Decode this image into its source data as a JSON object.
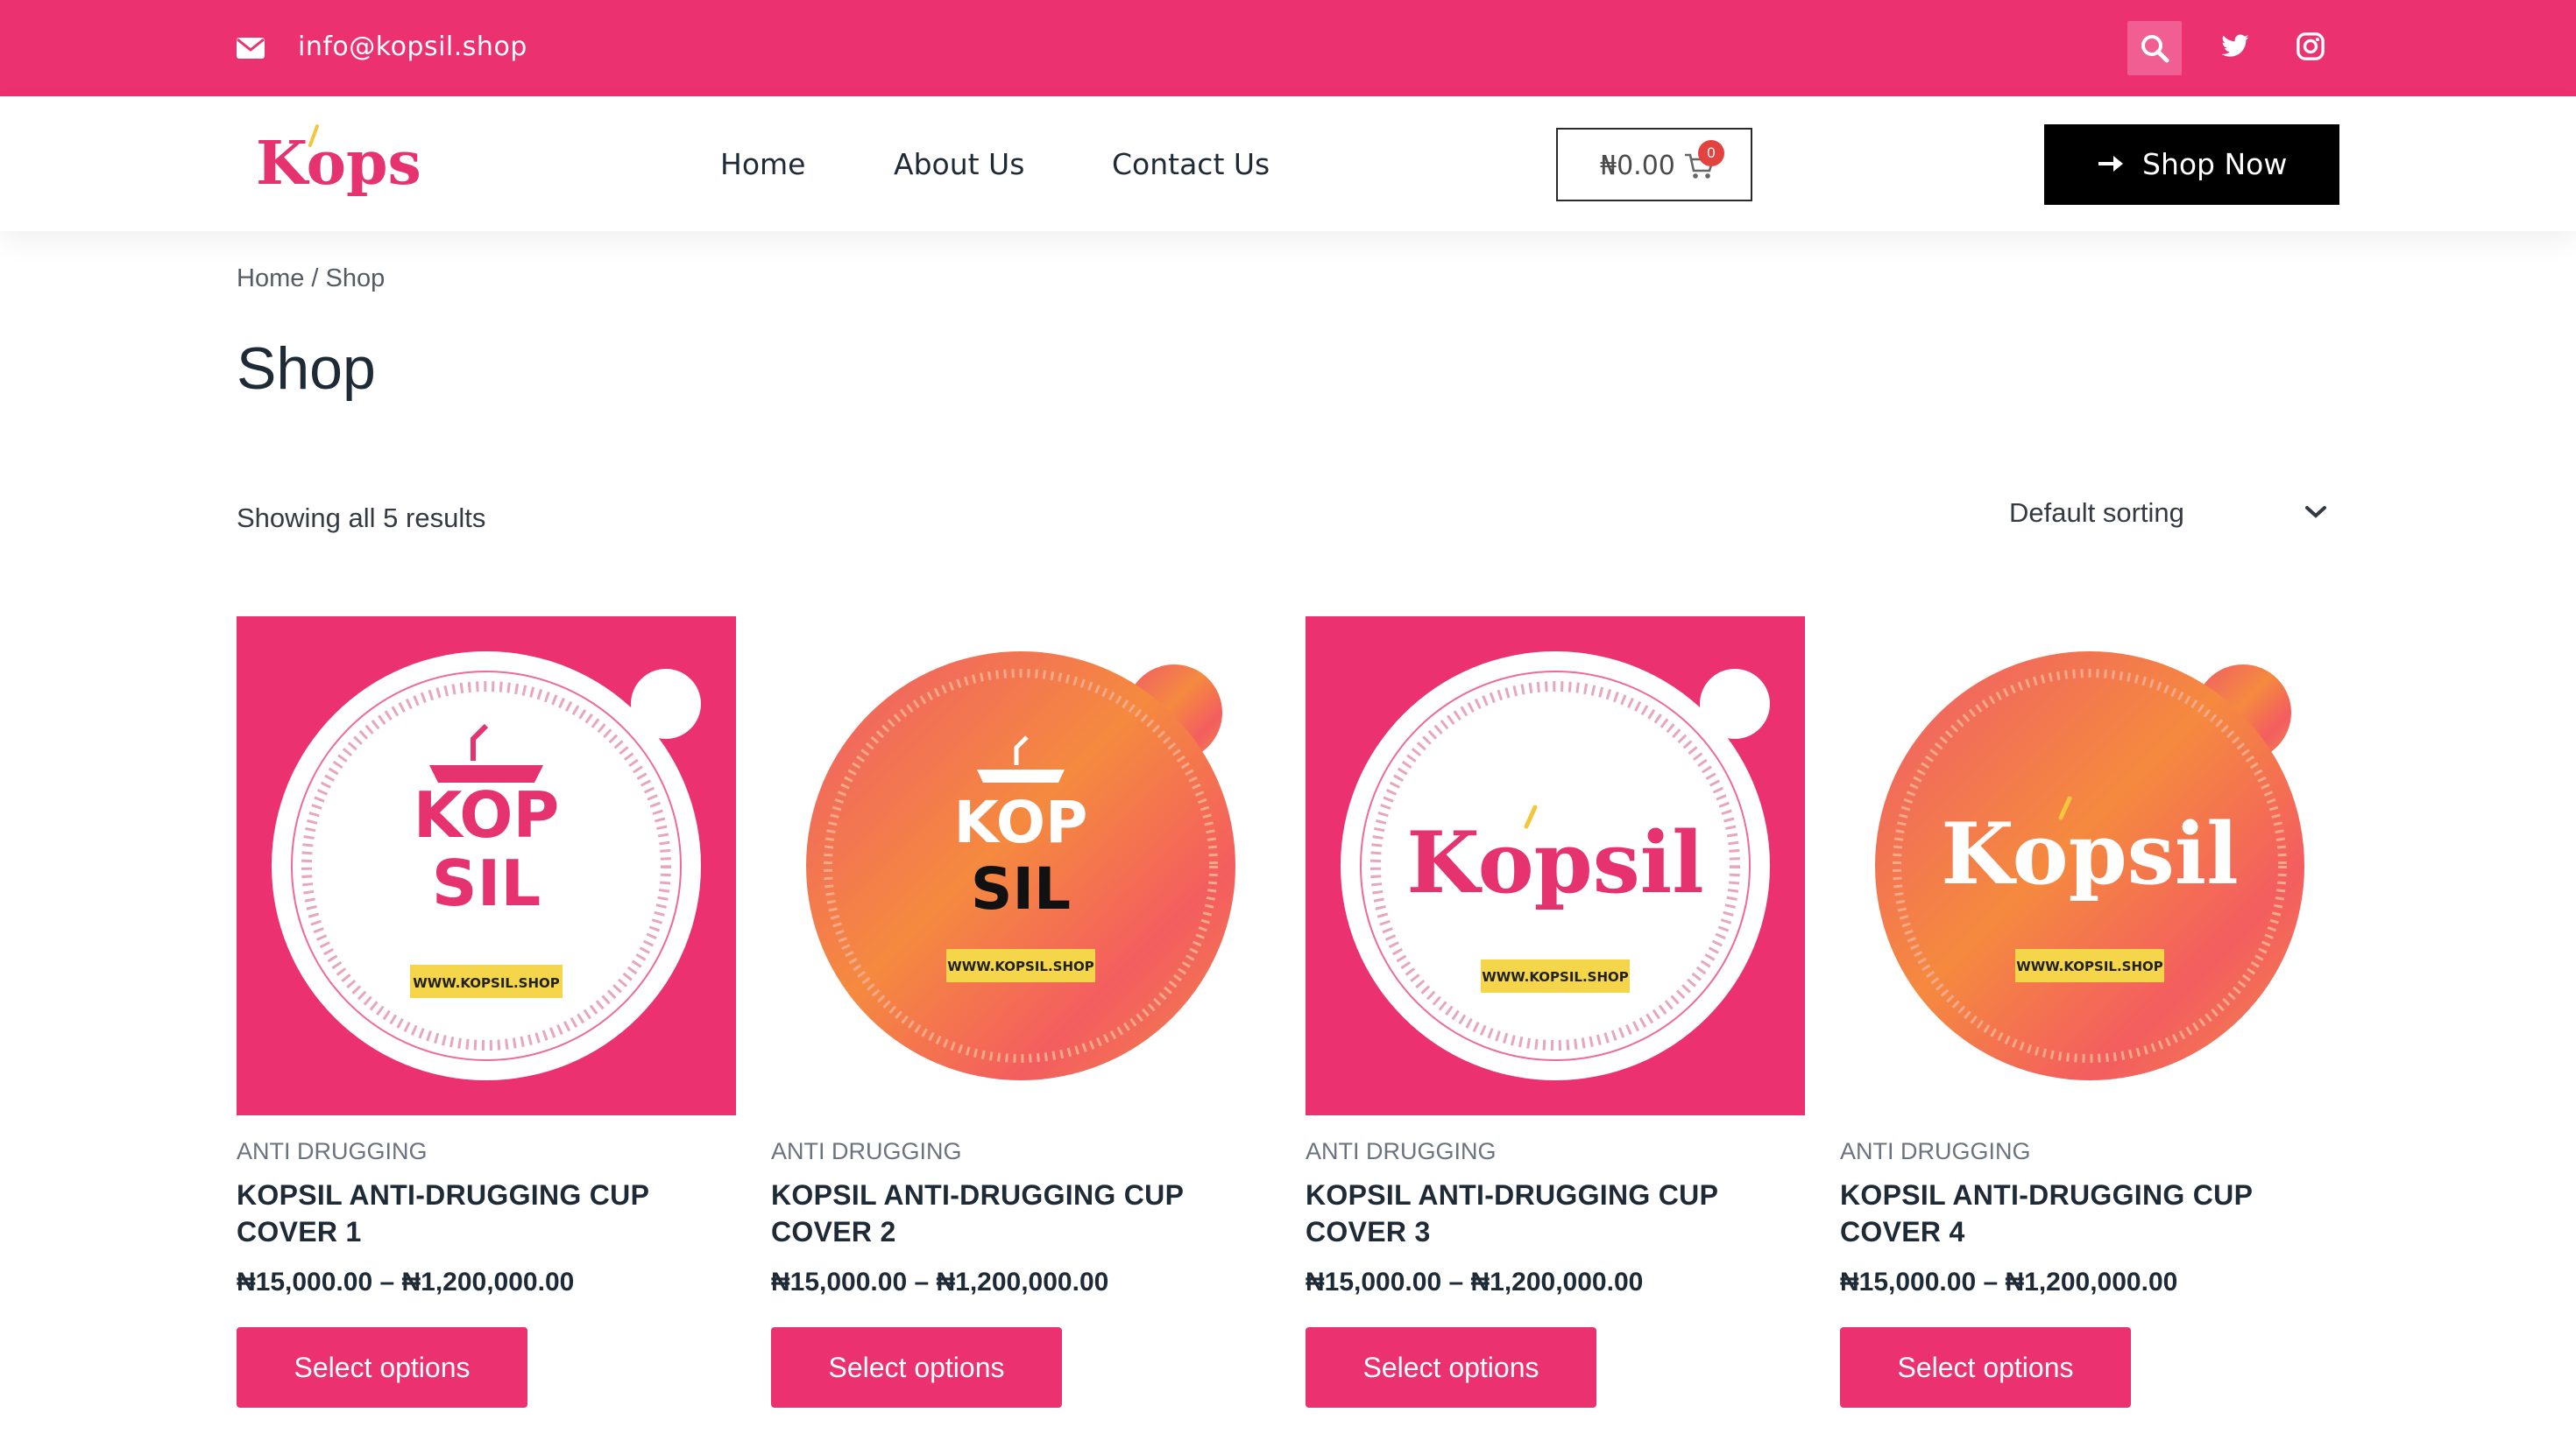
{
  "topbar": {
    "email": "info@kopsil.shop",
    "icons": [
      "envelope-icon",
      "search-icon",
      "twitter-icon",
      "instagram-icon"
    ]
  },
  "header": {
    "logo_text": "Kopsil",
    "nav": [
      "Home",
      "About Us",
      "Contact Us"
    ],
    "cart_amount": "₦0.00",
    "cart_count": "0",
    "cta_label": "Shop Now"
  },
  "breadcrumb": {
    "home": "Home",
    "separator": " / ",
    "current": "Shop"
  },
  "page": {
    "title": "Shop",
    "results_text": "Showing all 5 results",
    "sorting": "Default sorting"
  },
  "products": [
    {
      "category": "ANTI DRUGGING",
      "name": "KOPSIL ANTI-DRUGGING CUP COVER 1",
      "price": "₦15,000.00 – ₦1,200,000.00",
      "button": "Select options",
      "image_text": {
        "line1": "KOP",
        "line2": "SIL",
        "url": "WWW.KOPSIL.SHOP"
      }
    },
    {
      "category": "ANTI DRUGGING",
      "name": "KOPSIL ANTI-DRUGGING CUP COVER 2",
      "price": "₦15,000.00 – ₦1,200,000.00",
      "button": "Select options",
      "image_text": {
        "line1": "KOP",
        "line2": "SIL",
        "url": "WWW.KOPSIL.SHOP"
      }
    },
    {
      "category": "ANTI DRUGGING",
      "name": "KOPSIL ANTI-DRUGGING CUP COVER 3",
      "price": "₦15,000.00 – ₦1,200,000.00",
      "button": "Select options",
      "image_text": {
        "logo": "Kopsil",
        "url": "WWW.KOPSIL.SHOP"
      }
    },
    {
      "category": "ANTI DRUGGING",
      "name": "KOPSIL ANTI-DRUGGING CUP COVER 4",
      "price": "₦15,000.00 – ₦1,200,000.00",
      "button": "Select options",
      "image_text": {
        "logo": "Kopsil",
        "url": "WWW.KOPSIL.SHOP"
      }
    }
  ],
  "colors": {
    "brand_pink": "#ec3170",
    "black": "#000000",
    "orange": "#f5883a",
    "yellow": "#f5d54a"
  }
}
